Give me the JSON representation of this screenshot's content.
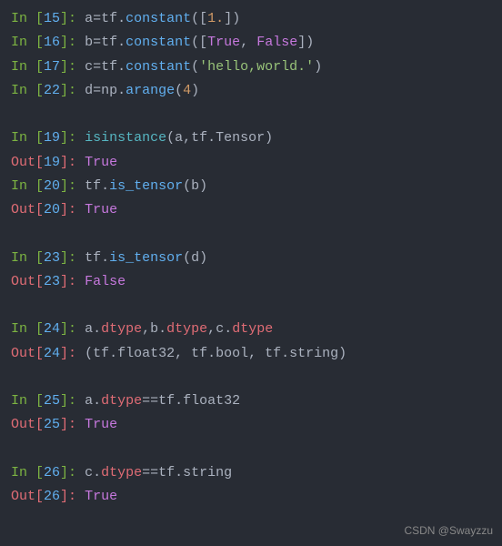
{
  "lines": {
    "l1": {
      "prompt_type": "In ",
      "num": "15",
      "code": {
        "var": "a",
        "assign": "=",
        "obj": "tf",
        "method": "constant",
        "open": "(",
        "bopen": "[",
        "arg": "1.",
        "bclose": "]",
        "close": ")"
      }
    },
    "l2": {
      "prompt_type": "In ",
      "num": "16",
      "code": {
        "var": "b",
        "assign": "=",
        "obj": "tf",
        "method": "constant",
        "open": "(",
        "bopen": "[",
        "a1": "True",
        "comma": ", ",
        "a2": "False",
        "bclose": "]",
        "close": ")"
      }
    },
    "l3": {
      "prompt_type": "In ",
      "num": "17",
      "code": {
        "var": "c",
        "assign": "=",
        "obj": "tf",
        "method": "constant",
        "open": "(",
        "str": "'hello,world.'",
        "close": ")"
      }
    },
    "l4": {
      "prompt_type": "In ",
      "num": "22",
      "code": {
        "var": "d",
        "assign": "=",
        "obj": "np",
        "method": "arange",
        "open": "(",
        "arg": "4",
        "close": ")"
      }
    },
    "l5": {
      "prompt_type": "In ",
      "num": "19",
      "code": {
        "func": "isinstance",
        "open": "(",
        "arg1": "a",
        "comma": ",",
        "obj": "tf",
        "dot": ".",
        "attr": "Tensor",
        "close": ")"
      }
    },
    "l6": {
      "prompt_type": "Out",
      "num": "19",
      "out": "True"
    },
    "l7": {
      "prompt_type": "In ",
      "num": "20",
      "code": {
        "obj": "tf",
        "method": "is_tensor",
        "open": "(",
        "arg": "b",
        "close": ")"
      }
    },
    "l8": {
      "prompt_type": "Out",
      "num": "20",
      "out": "True"
    },
    "l9": {
      "prompt_type": "In ",
      "num": "23",
      "code": {
        "obj": "tf",
        "method": "is_tensor",
        "open": "(",
        "arg": "d",
        "close": ")"
      }
    },
    "l10": {
      "prompt_type": "Out",
      "num": "23",
      "out": "False"
    },
    "l11": {
      "prompt_type": "In ",
      "num": "24",
      "code": {
        "a1": "a",
        "d1": ".",
        "p1": "dtype",
        "c1": ",",
        "a2": "b",
        "d2": ".",
        "p2": "dtype",
        "c2": ",",
        "a3": "c",
        "d3": ".",
        "p3": "dtype"
      }
    },
    "l12": {
      "prompt_type": "Out",
      "num": "24",
      "out": "(tf.float32, tf.bool, tf.string)"
    },
    "l13": {
      "prompt_type": "In ",
      "num": "25",
      "code": {
        "var": "a",
        "d": ".",
        "p": "dtype",
        "eq": "==",
        "obj": "tf",
        "d2": ".",
        "attr": "float32"
      }
    },
    "l14": {
      "prompt_type": "Out",
      "num": "25",
      "out": "True"
    },
    "l15": {
      "prompt_type": "In ",
      "num": "26",
      "code": {
        "var": "c",
        "d": ".",
        "p": "dtype",
        "eq": "==",
        "obj": "tf",
        "d2": ".",
        "attr": "string"
      }
    },
    "l16": {
      "prompt_type": "Out",
      "num": "26",
      "out": "True"
    }
  },
  "watermark": "CSDN @Swayzzu"
}
